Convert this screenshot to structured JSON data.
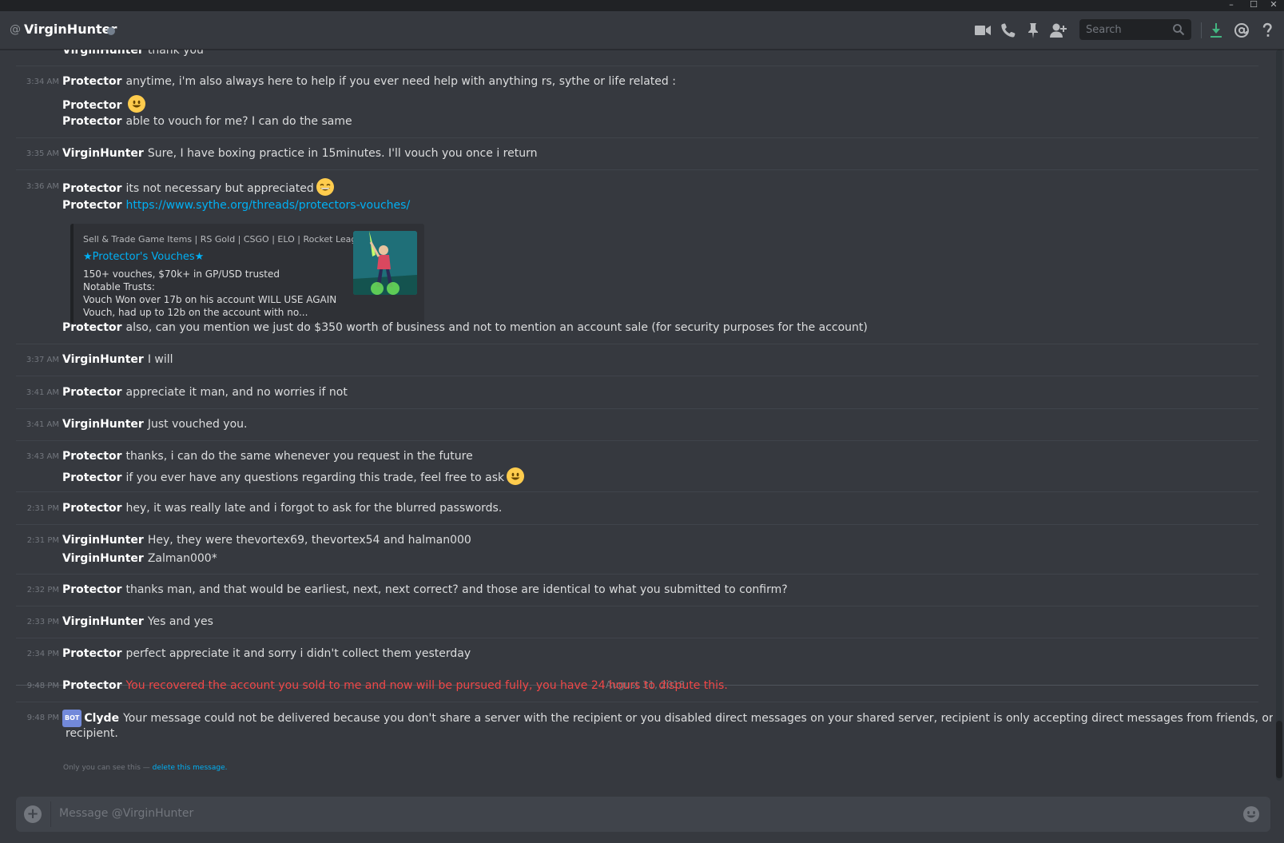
{
  "header": {
    "at_symbol": "@",
    "channel_name": "VirginHunter",
    "search_placeholder": "Search"
  },
  "window_controls": [
    "–",
    "☐",
    "✕"
  ],
  "messages": [
    {
      "time": "",
      "user": "VirginHunter",
      "text": "thank you"
    },
    {
      "time": "3:34 AM",
      "user": "Protector",
      "text": "anytime, i'm also always here to help if you ever need help with anything rs, sythe or life related :"
    },
    {
      "time": "",
      "user": "Protector",
      "text": ""
    },
    {
      "time": "",
      "user": "Protector",
      "text": "able to vouch for me? I can do the same"
    },
    {
      "time": "3:35 AM",
      "user": "VirginHunter",
      "text": "Sure, I have boxing practice in 15minutes. I'll vouch you once i return"
    },
    {
      "time": "3:36 AM",
      "user": "Protector",
      "text": "its not necessary but appreciated"
    },
    {
      "time": "",
      "user": "Protector",
      "text": "https://www.sythe.org/threads/protectors-vouches/"
    },
    {
      "time": "",
      "user": "Protector",
      "text": "also, can you mention we just do $350 worth of business and not to mention an account sale (for security purposes for the account)"
    },
    {
      "time": "3:37 AM",
      "user": "VirginHunter",
      "text": "I will"
    },
    {
      "time": "3:41 AM",
      "user": "Protector",
      "text": "appreciate it man, and no worries if not"
    },
    {
      "time": "3:41 AM",
      "user": "VirginHunter",
      "text": "Just vouched you."
    },
    {
      "time": "3:43 AM",
      "user": "Protector",
      "text": "thanks, i can do the same whenever you request in the future"
    },
    {
      "time": "",
      "user": "Protector",
      "text": "if you ever have any questions regarding this trade, feel free to ask"
    },
    {
      "time": "2:31 PM",
      "user": "Protector",
      "text": "hey, it was really late and i forgot to ask for the blurred passwords."
    },
    {
      "time": "2:31 PM",
      "user": "VirginHunter",
      "text": "Hey, they were thevortex69, thevortex54 and halman000"
    },
    {
      "time": "",
      "user": "VirginHunter",
      "text": "Zalman000*"
    },
    {
      "time": "2:32 PM",
      "user": "Protector",
      "text": "thanks man, and that would be earliest, next, next correct? and those are identical to what you submitted to confirm?"
    },
    {
      "time": "2:33 PM",
      "user": "VirginHunter",
      "text": "Yes and yes"
    },
    {
      "time": "2:34 PM",
      "user": "Protector",
      "text": "perfect appreciate it and sorry i didn't collect them yesterday"
    },
    {
      "time": "9:48 PM",
      "user": "Protector",
      "text": "You recovered the account you sold to me and now will be pursued fully, you have 24 hours to dispute this."
    },
    {
      "time": "9:48 PM",
      "user": "Clyde",
      "text": "Your message could not be delivered because you don't share a server with the recipient or you disabled direct messages on your shared server, recipient is only accepting direct messages from friends, or you were blocked by the",
      "text2": "recipient."
    }
  ],
  "embed": {
    "provider": "Sell & Trade Game Items | RS Gold | CSGO | ELO | Rocket League",
    "title": "★Protector's Vouches★",
    "description": "150+ vouches, $70k+ in GP/USD trusted\nNotable Trusts:\nVouch Won over 17b on his account WILL USE AGAIN\nVouch, had up to 12b on the account with no..."
  },
  "date_divider": "August 31, 2018",
  "bot_tag": "BOT",
  "ephemeral": {
    "prefix": "Only you can see this — ",
    "link": "delete this message."
  },
  "input": {
    "placeholder": "Message @VirginHunter"
  },
  "colors": {
    "link": "#00b0f4",
    "error": "#f04747",
    "bot": "#7289da",
    "background": "#36393f"
  }
}
